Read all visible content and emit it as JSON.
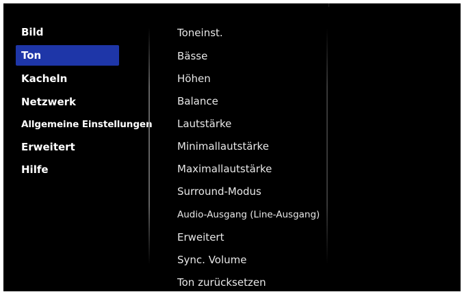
{
  "left_menu": {
    "items": [
      {
        "label": "Bild"
      },
      {
        "label": "Ton"
      },
      {
        "label": "Kacheln"
      },
      {
        "label": "Netzwerk"
      },
      {
        "label": "Allgemeine Einstellungen"
      },
      {
        "label": "Erweitert"
      },
      {
        "label": "Hilfe"
      }
    ],
    "selected_index": 1
  },
  "right_menu": {
    "items": [
      {
        "label": "Toneinst."
      },
      {
        "label": "Bässe"
      },
      {
        "label": "Höhen"
      },
      {
        "label": "Balance"
      },
      {
        "label": "Lautstärke"
      },
      {
        "label": "Minimallautstärke"
      },
      {
        "label": "Maximallautstärke"
      },
      {
        "label": "Surround-Modus"
      },
      {
        "label": "Audio-Ausgang (Line-Ausgang)"
      },
      {
        "label": "Erweitert"
      },
      {
        "label": "Sync. Volume"
      },
      {
        "label": "Ton zurücksetzen"
      }
    ]
  },
  "colors": {
    "background": "#000000",
    "selection": "#1e36a8",
    "text": "#ffffff"
  }
}
